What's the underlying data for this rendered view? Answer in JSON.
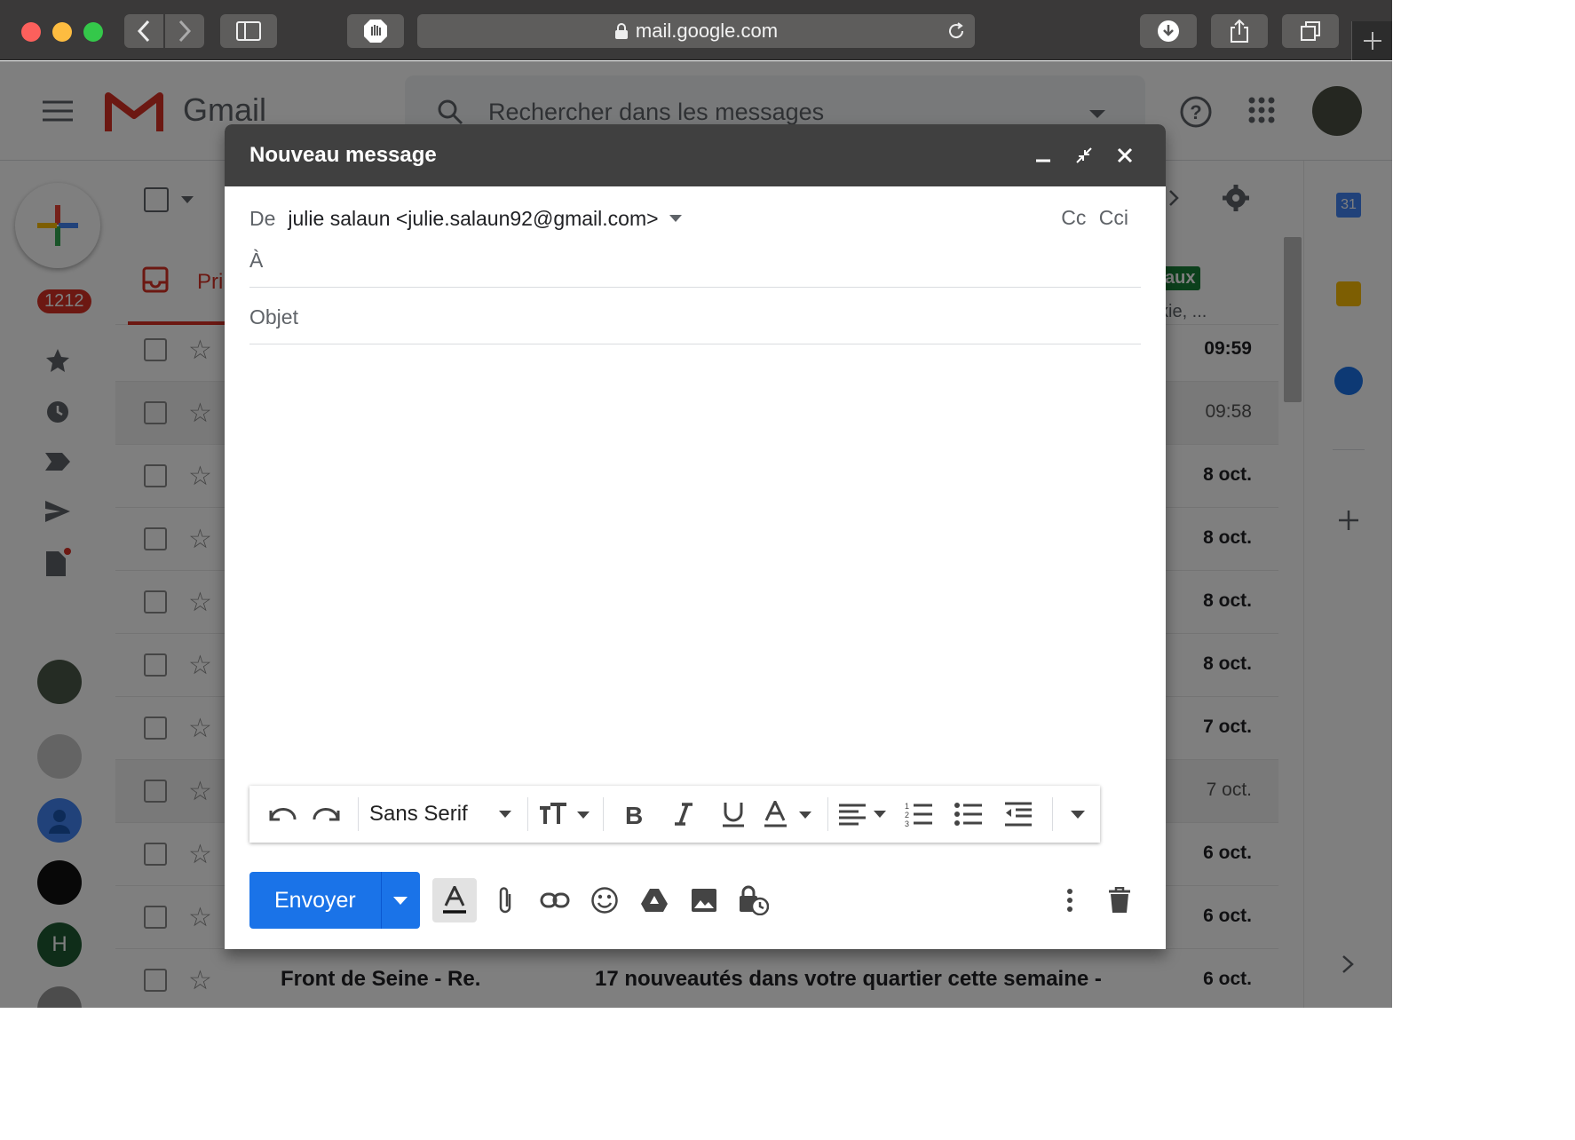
{
  "browser": {
    "url": "mail.google.com"
  },
  "gmail": {
    "logo_text": "Gmail",
    "search_placeholder": "Rechercher dans les messages",
    "unread_badge": "1212",
    "tab_primary": "Pri",
    "side_chip": "aux",
    "side_snippet": "kie, ...",
    "avatar_letter": "H",
    "calendar_day": "31",
    "rows": [
      {
        "date": "09:59",
        "read": false
      },
      {
        "date": "09:58",
        "read": true
      },
      {
        "date": "8 oct.",
        "read": false
      },
      {
        "date": "8 oct.",
        "read": false
      },
      {
        "date": "8 oct.",
        "read": false
      },
      {
        "date": "8 oct.",
        "read": false
      },
      {
        "date": "7 oct.",
        "read": false
      },
      {
        "date": "7 oct.",
        "read": true
      },
      {
        "date": "6 oct.",
        "read": false
      },
      {
        "date": "6 oct.",
        "read": false
      },
      {
        "date": "6 oct.",
        "read": false,
        "sender": "Front de Seine - Re.",
        "subject": "17 nouveautés dans votre quartier cette semaine -"
      }
    ]
  },
  "compose": {
    "title": "Nouveau message",
    "from_label": "De",
    "from_value": "julie salaun <julie.salaun92@gmail.com>",
    "cc": "Cc",
    "cci": "Cci",
    "to_label": "À",
    "subject_placeholder": "Objet",
    "font_name": "Sans Serif",
    "send_label": "Envoyer"
  },
  "colors": {
    "send_button": "#1a73e8",
    "compose_header": "#404040",
    "gmail_red": "#d93025"
  }
}
